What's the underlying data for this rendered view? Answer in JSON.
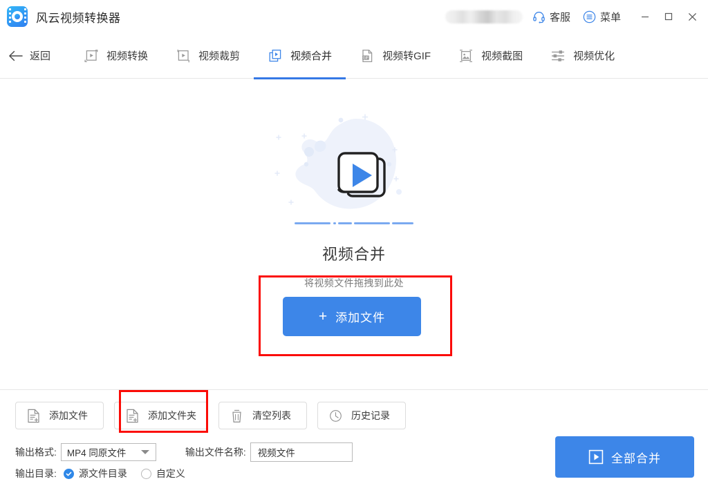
{
  "app": {
    "title": "风云视频转换器",
    "logo_icon": "app-logo-film-icon"
  },
  "titlebar": {
    "user_badge": "",
    "service_label": "客服",
    "service_icon": "headset-icon",
    "menu_label": "菜单",
    "menu_icon": "list-menu-icon",
    "minimize_icon": "minimize-icon",
    "maximize_icon": "maximize-icon",
    "close_icon": "close-icon"
  },
  "nav": {
    "back_label": "返回",
    "back_icon": "arrow-left-icon",
    "tabs": [
      {
        "label": "视频转换",
        "icon": "video-convert-icon",
        "active": false
      },
      {
        "label": "视频裁剪",
        "icon": "video-crop-icon",
        "active": false
      },
      {
        "label": "视频合并",
        "icon": "video-merge-icon",
        "active": true
      },
      {
        "label": "视频转GIF",
        "icon": "gif-icon",
        "active": false
      },
      {
        "label": "视频截图",
        "icon": "screenshot-icon",
        "active": false
      },
      {
        "label": "视频优化",
        "icon": "sliders-icon",
        "active": false
      }
    ]
  },
  "hero": {
    "illustration_icon": "stacked-video-play-icon",
    "title": "视频合并",
    "subtitle": "将视频文件拖拽到此处",
    "add_button_label": "添加文件",
    "add_button_plus": "+"
  },
  "toolbar": {
    "buttons": [
      {
        "label": "添加文件",
        "icon": "file-add-icon",
        "highlighted": false
      },
      {
        "label": "添加文件夹",
        "icon": "folder-add-icon",
        "highlighted": true
      },
      {
        "label": "清空列表",
        "icon": "trash-icon",
        "highlighted": false
      },
      {
        "label": "历史记录",
        "icon": "clock-icon",
        "highlighted": false
      }
    ]
  },
  "settings": {
    "format_label": "输出格式:",
    "format_value": "MP4 同原文件",
    "format_caret_icon": "chevron-down-icon",
    "filename_label": "输出文件名称:",
    "filename_value": "视频文件",
    "filename_placeholder": "视频文件",
    "dir_label": "输出目录:",
    "dir_options": [
      {
        "label": "源文件目录",
        "selected": true
      },
      {
        "label": "自定义",
        "selected": false
      }
    ]
  },
  "action": {
    "merge_label": "全部合并",
    "merge_icon": "play-square-icon"
  },
  "colors": {
    "accent": "#3d86e8",
    "accent_dark": "#3578e5",
    "annotation": "#fb0b06",
    "text": "#3c3c3c",
    "muted": "#7b7b7b",
    "border": "#dcdcdc"
  }
}
